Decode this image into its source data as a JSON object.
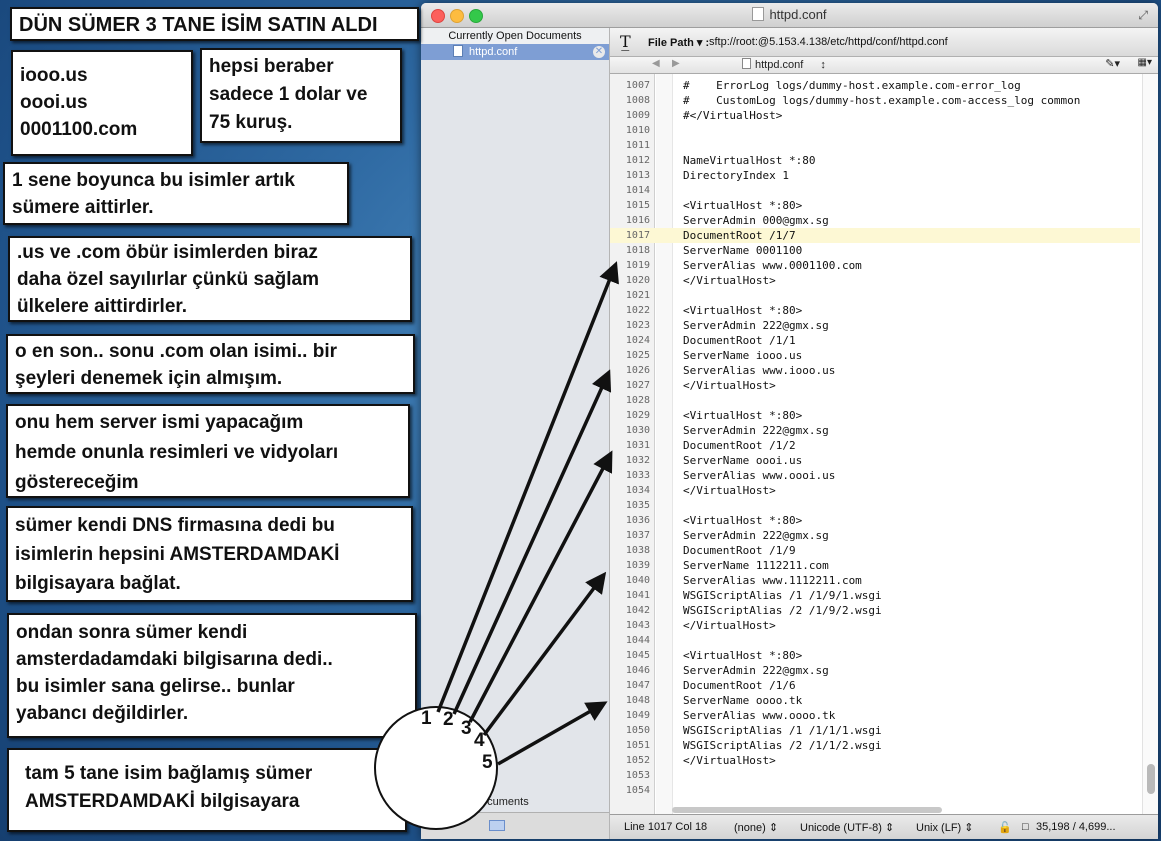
{
  "window": {
    "title": "httpd.conf",
    "sidebar_header": "Currently Open Documents",
    "sidebar_item": "httpd.conf",
    "sidebar_bottom_label": "ocuments",
    "file_path_label": "File Path ▾ :",
    "file_path_value": "sftp://root:@5.153.4.138/etc/httpd/conf/httpd.conf",
    "nav_file": "httpd.conf",
    "nav_file_arrows": "↕",
    "status": {
      "position": "Line 1017 Col 18",
      "language": "(none)",
      "encoding": "Unicode (UTF-8)",
      "line_endings": "Unix (LF)",
      "counts": "35,198 / 4,699..."
    }
  },
  "editor": {
    "highlight_line": 1017,
    "lines": [
      {
        "n": "1007",
        "t": "#    ErrorLog logs/dummy-host.example.com-error_log"
      },
      {
        "n": "1008",
        "t": "#    CustomLog logs/dummy-host.example.com-access_log common"
      },
      {
        "n": "1009",
        "t": "#</VirtualHost>"
      },
      {
        "n": "1010",
        "t": ""
      },
      {
        "n": "1011",
        "t": ""
      },
      {
        "n": "1012",
        "t": "NameVirtualHost *:80"
      },
      {
        "n": "1013",
        "t": "DirectoryIndex 1"
      },
      {
        "n": "1014",
        "t": ""
      },
      {
        "n": "1015",
        "t": "<VirtualHost *:80>"
      },
      {
        "n": "1016",
        "t": "ServerAdmin 000@gmx.sg"
      },
      {
        "n": "1017",
        "t": "DocumentRoot /1/7"
      },
      {
        "n": "1018",
        "t": "ServerName 0001100"
      },
      {
        "n": "1019",
        "t": "ServerAlias www.0001100.com"
      },
      {
        "n": "1020",
        "t": "</VirtualHost>"
      },
      {
        "n": "1021",
        "t": ""
      },
      {
        "n": "1022",
        "t": "<VirtualHost *:80>"
      },
      {
        "n": "1023",
        "t": "ServerAdmin 222@gmx.sg"
      },
      {
        "n": "1024",
        "t": "DocumentRoot /1/1"
      },
      {
        "n": "1025",
        "t": "ServerName iooo.us"
      },
      {
        "n": "1026",
        "t": "ServerAlias www.iooo.us"
      },
      {
        "n": "1027",
        "t": "</VirtualHost>"
      },
      {
        "n": "1028",
        "t": ""
      },
      {
        "n": "1029",
        "t": "<VirtualHost *:80>"
      },
      {
        "n": "1030",
        "t": "ServerAdmin 222@gmx.sg"
      },
      {
        "n": "1031",
        "t": "DocumentRoot /1/2"
      },
      {
        "n": "1032",
        "t": "ServerName oooi.us"
      },
      {
        "n": "1033",
        "t": "ServerAlias www.oooi.us"
      },
      {
        "n": "1034",
        "t": "</VirtualHost>"
      },
      {
        "n": "1035",
        "t": ""
      },
      {
        "n": "1036",
        "t": "<VirtualHost *:80>"
      },
      {
        "n": "1037",
        "t": "ServerAdmin 222@gmx.sg"
      },
      {
        "n": "1038",
        "t": "DocumentRoot /1/9"
      },
      {
        "n": "1039",
        "t": "ServerName 1112211.com"
      },
      {
        "n": "1040",
        "t": "ServerAlias www.1112211.com"
      },
      {
        "n": "1041",
        "t": "WSGIScriptAlias /1 /1/9/1.wsgi"
      },
      {
        "n": "1042",
        "t": "WSGIScriptAlias /2 /1/9/2.wsgi"
      },
      {
        "n": "1043",
        "t": "</VirtualHost>"
      },
      {
        "n": "1044",
        "t": ""
      },
      {
        "n": "1045",
        "t": "<VirtualHost *:80>"
      },
      {
        "n": "1046",
        "t": "ServerAdmin 222@gmx.sg"
      },
      {
        "n": "1047",
        "t": "DocumentRoot /1/6"
      },
      {
        "n": "1048",
        "t": "ServerName oooo.tk"
      },
      {
        "n": "1049",
        "t": "ServerAlias www.oooo.tk"
      },
      {
        "n": "1050",
        "t": "WSGIScriptAlias /1 /1/1/1.wsgi"
      },
      {
        "n": "1051",
        "t": "WSGIScriptAlias /2 /1/1/2.wsgi"
      },
      {
        "n": "1052",
        "t": "</VirtualHost>"
      },
      {
        "n": "1053",
        "t": ""
      },
      {
        "n": "1054",
        "t": ""
      }
    ]
  },
  "notes": {
    "title": "DÜN SÜMER 3 TANE İSİM SATIN ALDI",
    "domains": "iooo.us\noooi.us\n0001100.com",
    "price": "hepsi beraber\nsadece 1 dolar ve\n75 kuruş.",
    "year": "1 sene boyunca bu isimler artık\nsümere aittirler.",
    "special": ".us ve .com öbür isimlerden biraz\ndaha özel sayılırlar çünkü sağlam\nülkelere aittirdirler.",
    "com": "o en son.. sonu   .com  olan isimi.. bir\nşeyleri denemek için almışım.",
    "server": "onu hem server ismi yapacağım\nhemde onunla resimleri ve vidyoları\ngöstereceğim",
    "dns": "sümer kendi DNS firmasına dedi bu\nisimlerin hepsini AMSTERDAMDAKİ\nbilgisayara bağlat.",
    "amsterdam": "ondan sonra sümer kendi\namsterdadamdaki bilgisarına dedi..\nbu isimler sana gelirse.. bunlar\nyabancı değildirler.",
    "summary": "tam 5 tane isim bağlamış sümer\nAMSTERDAMDAKİ bilgisayara"
  },
  "dial_numbers": [
    "1",
    "2",
    "3",
    "4",
    "5"
  ]
}
